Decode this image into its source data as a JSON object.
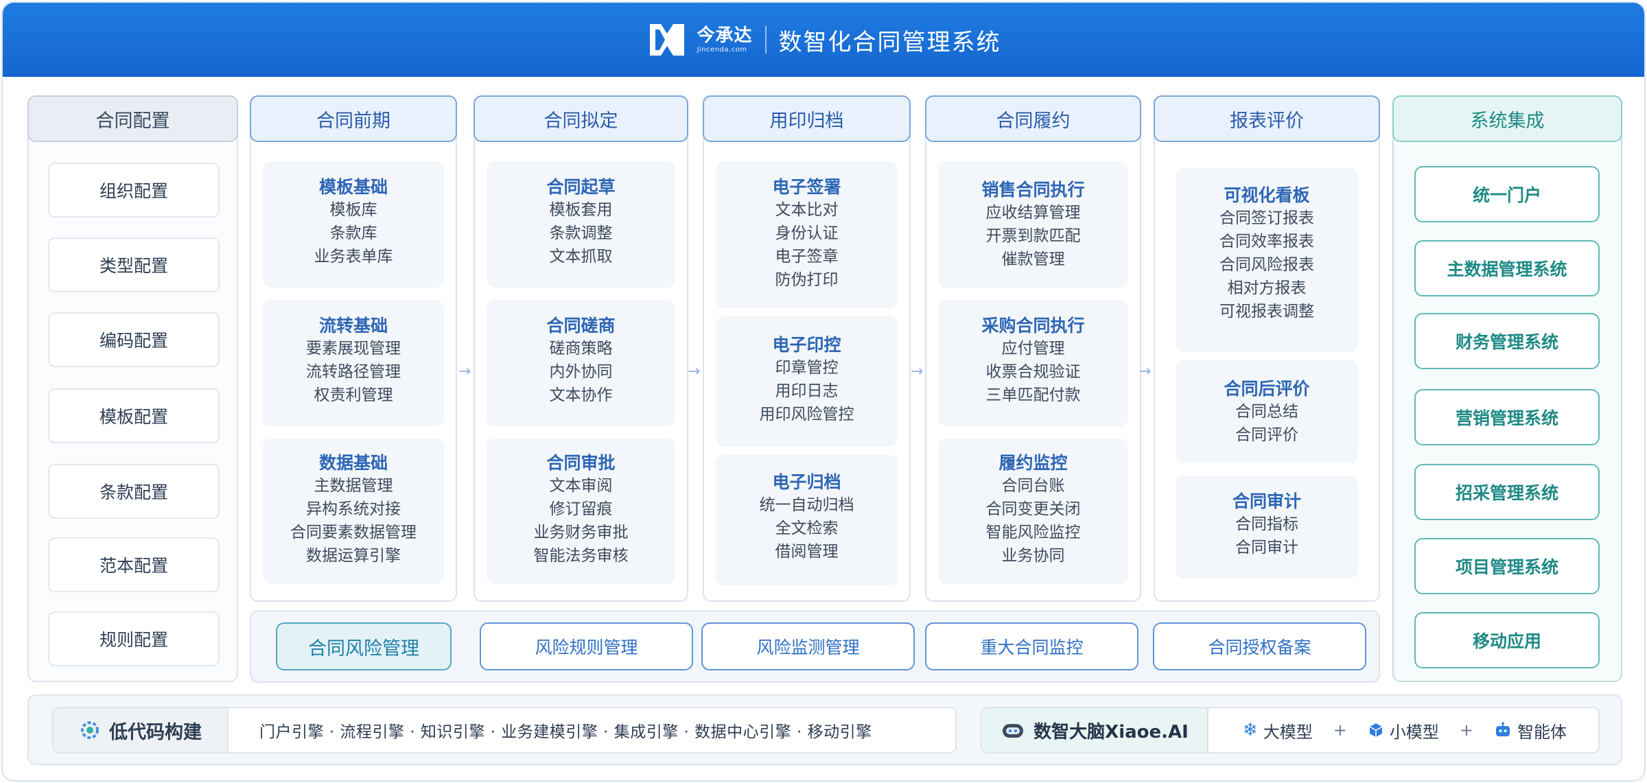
{
  "header": {
    "logo_cn": "今承达",
    "logo_en": "Jincenda.com",
    "title": "数智化合同管理系统",
    "brand_color": "#1a72da"
  },
  "config": {
    "head": "合同配置",
    "items": [
      "组织配置",
      "类型配置",
      "编码配置",
      "模板配置",
      "条款配置",
      "范本配置",
      "规则配置"
    ]
  },
  "columns": [
    {
      "head": "合同前期",
      "cards": [
        {
          "title": "模板基础",
          "lines": [
            "模板库",
            "条款库",
            "业务表单库"
          ]
        },
        {
          "title": "流转基础",
          "lines": [
            "要素展现管理",
            "流转路径管理",
            "权责利管理"
          ]
        },
        {
          "title": "数据基础",
          "lines": [
            "主数据管理",
            "异构系统对接",
            "合同要素数据管理",
            "数据运算引擎"
          ]
        }
      ]
    },
    {
      "head": "合同拟定",
      "cards": [
        {
          "title": "合同起草",
          "lines": [
            "模板套用",
            "条款调整",
            "文本抓取"
          ]
        },
        {
          "title": "合同磋商",
          "lines": [
            "磋商策略",
            "内外协同",
            "文本协作"
          ]
        },
        {
          "title": "合同审批",
          "lines": [
            "文本审阅",
            "修订留痕",
            "业务财务审批",
            "智能法务审核"
          ]
        }
      ]
    },
    {
      "head": "用印归档",
      "cards": [
        {
          "title": "电子签署",
          "lines": [
            "文本比对",
            "身份认证",
            "电子签章",
            "防伪打印"
          ]
        },
        {
          "title": "电子印控",
          "lines": [
            "印章管控",
            "用印日志",
            "用印风险管控"
          ]
        },
        {
          "title": "电子归档",
          "lines": [
            "统一自动归档",
            "全文检索",
            "借阅管理"
          ]
        }
      ]
    },
    {
      "head": "合同履约",
      "cards": [
        {
          "title": "销售合同执行",
          "lines": [
            "应收结算管理",
            "开票到款匹配",
            "催款管理"
          ]
        },
        {
          "title": "采购合同执行",
          "lines": [
            "应付管理",
            "收票合规验证",
            "三单匹配付款"
          ]
        },
        {
          "title": "履约监控",
          "lines": [
            "合同台账",
            "合同变更关闭",
            "智能风险监控",
            "业务协同"
          ]
        }
      ]
    },
    {
      "head": "报表评价",
      "cards": [
        {
          "title": "可视化看板",
          "lines": [
            "合同签订报表",
            "合同效率报表",
            "合同风险报表",
            "相对方报表",
            "可视报表调整"
          ]
        },
        {
          "title": "合同后评价",
          "lines": [
            "合同总结",
            "合同评价"
          ]
        },
        {
          "title": "合同审计",
          "lines": [
            "合同指标",
            "合同审计"
          ]
        }
      ]
    }
  ],
  "risk": {
    "main": "合同风险管理",
    "items": [
      "风险规则管理",
      "风险监测管理",
      "重大合同监控",
      "合同授权备案"
    ]
  },
  "integration": {
    "head": "系统集成",
    "items": [
      "统一门户",
      "主数据管理系统",
      "财务管理系统",
      "营销管理系统",
      "招采管理系统",
      "项目管理系统",
      "移动应用"
    ]
  },
  "bottom": {
    "lowcode_label": "低代码构建",
    "engines": "门户引擎 · 流程引擎 · 知识引擎 · 业务建模引擎 · 集成引擎 · 数据中心引擎 · 移动引擎",
    "ai_label": "数智大脑Xiaoe.AI",
    "models": [
      "大模型",
      "小模型",
      "智能体"
    ]
  }
}
